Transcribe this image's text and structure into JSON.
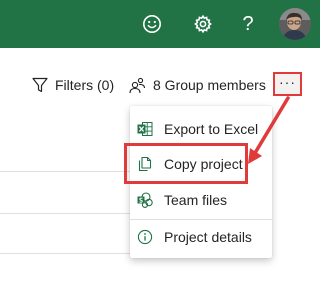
{
  "colors": {
    "brand_green": "#217346",
    "accent_red": "#e03a3a",
    "text": "#252423",
    "divider": "#e1dfdd"
  },
  "topbar": {
    "icons": [
      "smiley-icon",
      "settings-gear-icon",
      "help-icon",
      "user-avatar"
    ],
    "help_glyph": "?"
  },
  "toolbar": {
    "filters_label": "Filters (0)",
    "members_label": "8 Group members",
    "more_label": "···"
  },
  "menu": {
    "items": [
      {
        "label": "Export to Excel",
        "icon": "excel-icon"
      },
      {
        "label": "Copy project",
        "icon": "copy-icon"
      },
      {
        "label": "Team files",
        "icon": "sharepoint-icon"
      },
      {
        "label": "Project details",
        "icon": "info-icon"
      }
    ]
  }
}
